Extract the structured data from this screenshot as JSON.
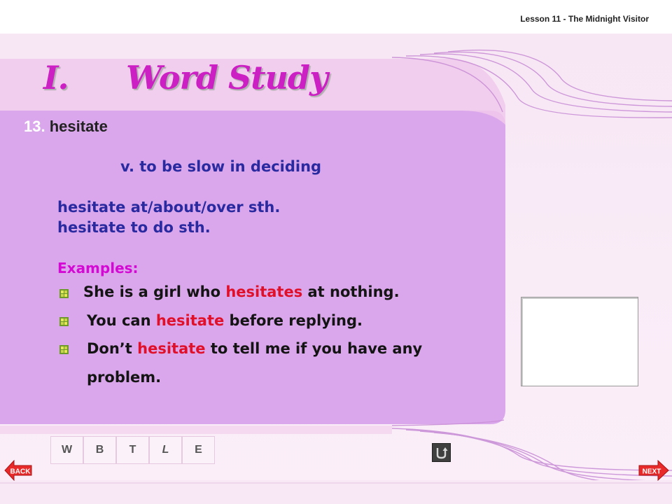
{
  "header": {
    "lesson_title": "Lesson 11 - The Midnight Visitor"
  },
  "section": {
    "number": "I.",
    "title": "Word Study"
  },
  "entry": {
    "number": "13.",
    "word": "hesitate",
    "definition": "v. to be slow in deciding",
    "patterns": [
      "hesitate at/about/over sth.",
      "hesitate to do sth."
    ]
  },
  "examples": {
    "title": "Examples:",
    "items": [
      {
        "before": "She is a girl who ",
        "highlight": "hesitates",
        "after": " at nothing."
      },
      {
        "before": "You can ",
        "highlight": "hesitate",
        "after": " before replying."
      },
      {
        "before": "Don’t ",
        "highlight": "hesitate",
        "after": " to tell me if you have any"
      },
      {
        "before": "problem.",
        "highlight": "",
        "after": ""
      }
    ]
  },
  "nav": {
    "tabs": [
      "W",
      "B",
      "T",
      "L",
      "E"
    ]
  },
  "buttons": {
    "back": "BACK",
    "next": "NEXT"
  },
  "colors": {
    "panel": "#dba7ec",
    "heading": "#cc1fc4",
    "highlight": "#e0102a",
    "pattern_text": "#2a2aa0",
    "examples_title": "#d40ad4"
  }
}
